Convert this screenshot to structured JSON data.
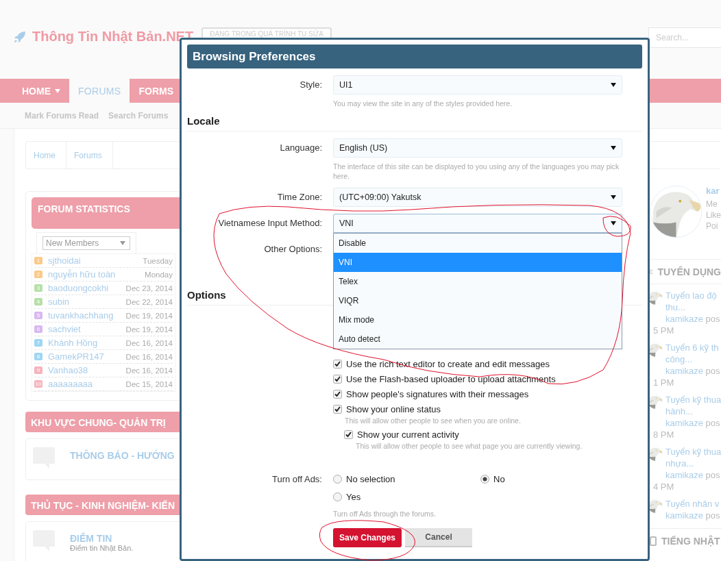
{
  "site": {
    "logo_text": "Thông Tin Nhật Bản.NET",
    "status_button": "ĐANG TRONG QUÁ TRÌNH TU SỬA",
    "search": {
      "placeholder": "Search..."
    }
  },
  "nav": {
    "tabs": [
      {
        "label": "HOME",
        "selected": false,
        "has_menu": true
      },
      {
        "label": "FORUMS",
        "selected": true,
        "has_menu": false
      },
      {
        "label": "FORMS",
        "selected": false,
        "has_menu": false
      }
    ],
    "sub_links": [
      "Mark Forums Read",
      "Search Forums"
    ]
  },
  "breadcrumb": [
    "Home",
    "Forums"
  ],
  "forum_statistics": {
    "title": "FORUM STATISTICS",
    "filter": "New Members",
    "members": [
      {
        "rank": "1",
        "name": "sjthoidai",
        "date": "Tuesday",
        "color": "#fcc98a"
      },
      {
        "rank": "2",
        "name": "nguyễn hữu toàn",
        "date": "Monday",
        "color": "#fcc98a"
      },
      {
        "rank": "3",
        "name": "baoduongcokhi",
        "date": "Dec 23, 2014",
        "color": "#b6e0a8"
      },
      {
        "rank": "4",
        "name": "subin",
        "date": "Dec 22, 2014",
        "color": "#b6e0a8"
      },
      {
        "rank": "5",
        "name": "tuvankhachhang",
        "date": "Dec 19, 2014",
        "color": "#d9b8f0"
      },
      {
        "rank": "6",
        "name": "sachviet",
        "date": "Dec 19, 2014",
        "color": "#d9b8f0"
      },
      {
        "rank": "7",
        "name": "Khánh Hồng",
        "date": "Dec 16, 2014",
        "color": "#9ed6f4"
      },
      {
        "rank": "8",
        "name": "GamekPR147",
        "date": "Dec 16, 2014",
        "color": "#9ed6f4"
      },
      {
        "rank": "9",
        "name": "Vanhao38",
        "date": "Dec 16, 2014",
        "color": "#f7b3bc"
      },
      {
        "rank": "10",
        "name": "aaaaaaaaa",
        "date": "Dec 15, 2014",
        "color": "#f7b3bc"
      }
    ]
  },
  "categories": [
    {
      "title": "KHU VỰC CHUNG- QUẢN TRỊ",
      "forums": [
        {
          "title": "THÔNG BÁO - HƯỚNG"
        }
      ]
    },
    {
      "title": "THỦ TỤC - KINH NGHIỆM- KIẾN",
      "forums": [
        {
          "title": "ĐIỂM TIN",
          "description": "Điểm tin Nhật Bản."
        }
      ]
    }
  ],
  "profile": {
    "name": "kar",
    "stats": [
      "Me",
      "Like",
      "Poi"
    ]
  },
  "recruitment": {
    "title": "TUYỂN DỤNG",
    "threads": [
      {
        "title_lines": [
          "Tuyển lao độ",
          "thu..."
        ],
        "author": "kamikaze",
        "action": "pos",
        "time": "5 PM"
      },
      {
        "title_lines": [
          "Tuyển 6 kỹ th",
          "công..."
        ],
        "author": "kamikaze",
        "action": "pos",
        "time": "1 PM"
      },
      {
        "title_lines": [
          "Tuyển kỹ thua",
          "hành..."
        ],
        "author": "kamikaze",
        "action": "pos",
        "time": "8 PM"
      },
      {
        "title_lines": [
          "Tuyển kỹ thua",
          "nhựa..."
        ],
        "author": "kamikaze",
        "action": "pos",
        "time": "4 PM"
      },
      {
        "title_lines": [
          "Tuyển nhân v"
        ],
        "author": "kamikaze",
        "action": "pos"
      }
    ]
  },
  "next_section": {
    "title": "TIẾNG NHẬT"
  },
  "dialog": {
    "title": "Browsing Preferences",
    "fields": [
      {
        "kind": "select",
        "label": "Style:",
        "value": "UI1",
        "hint": "You may view the site in any of the styles provided here."
      },
      {
        "kind": "heading",
        "label": "Locale"
      },
      {
        "kind": "select",
        "label": "Language:",
        "value": "English (US)",
        "hint": "The interface of this site can be displayed to you using any of the languages you may pick here."
      },
      {
        "kind": "select",
        "label": "Time Zone:",
        "value": "(UTC+09:00) Yakutsk"
      },
      {
        "kind": "select",
        "label": "Vietnamese Input Method:",
        "value": "VNI",
        "expanded": true,
        "options": [
          {
            "label": "Disable",
            "selected": false
          },
          {
            "label": "VNI",
            "selected": true
          },
          {
            "label": "Telex",
            "selected": false
          },
          {
            "label": "VIQR",
            "selected": false
          },
          {
            "label": "Mix mode",
            "selected": false
          },
          {
            "label": "Auto detect",
            "selected": false
          }
        ]
      },
      {
        "kind": "checks",
        "label": "Other Options:"
      },
      {
        "kind": "heading",
        "label": "Options"
      },
      {
        "kind": "checks",
        "items": [
          {
            "label": "Use the rich text editor to create and edit messages",
            "checked": true
          },
          {
            "label": "Use the Flash-based uploader to upload attachments",
            "checked": true
          },
          {
            "label": "Show people's signatures with their messages",
            "checked": true
          },
          {
            "label": "Show your online status",
            "checked": true,
            "hint": "This will allow other people to see when you are online.",
            "children": [
              {
                "label": "Show your current activity",
                "checked": true,
                "hint": "This will allow other people to see what page you are currently viewing."
              }
            ]
          }
        ]
      },
      {
        "kind": "radios",
        "label": "Turn off Ads:",
        "options": [
          {
            "label": "No selection",
            "selected": false
          },
          {
            "label": "No",
            "selected": true
          },
          {
            "label": "Yes",
            "selected": false
          }
        ],
        "hint": "Turn off Ads through the forums."
      }
    ],
    "buttons": [
      {
        "label": "Save Changes",
        "kind": "primary"
      },
      {
        "label": "Cancel",
        "kind": "secondary"
      }
    ]
  }
}
